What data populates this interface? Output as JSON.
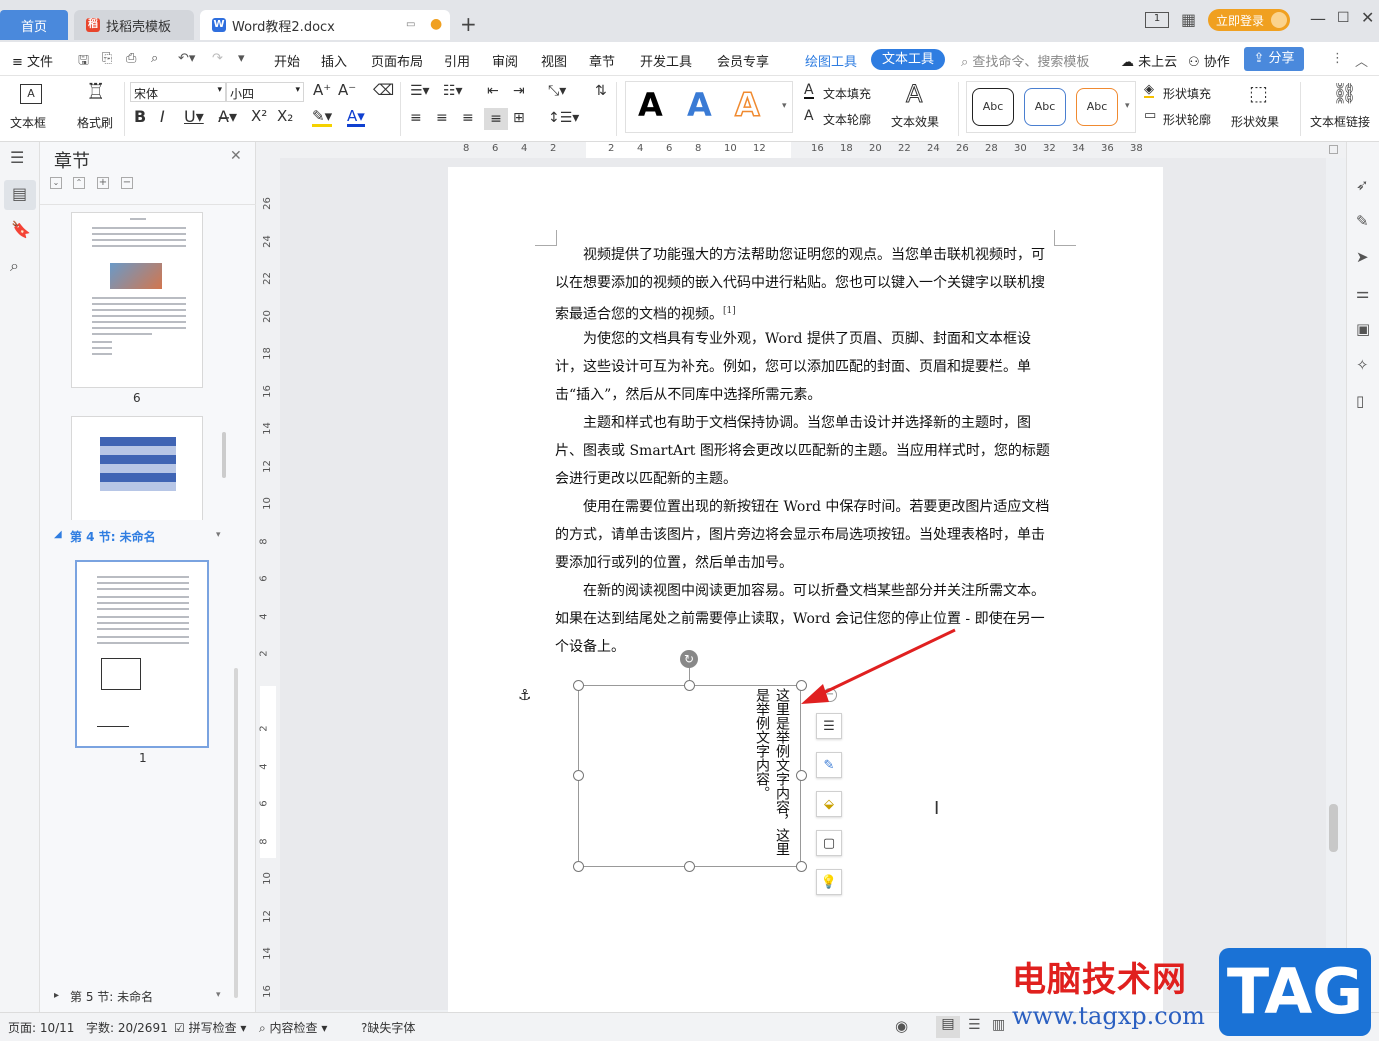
{
  "tabs": {
    "home": "首页",
    "template": "找稻壳模板",
    "doc": "Word教程2.docx",
    "new": "+"
  },
  "titlebar": {
    "login": "立即登录"
  },
  "menu": {
    "file": "文件",
    "items": [
      "开始",
      "插入",
      "页面布局",
      "引用",
      "审阅",
      "视图",
      "章节",
      "开发工具",
      "会员专享"
    ],
    "draw_tool": "绘图工具",
    "text_tool": "文本工具",
    "search": "查找命令、搜索模板",
    "cloud": "未上云",
    "collab": "协作",
    "share": "分享"
  },
  "ribbon": {
    "textbox": "文本框",
    "format_brush": "格式刷",
    "font": "宋体",
    "size": "小四",
    "text_fill": "文本填充",
    "text_outline": "文本轮廓",
    "text_effect": "文本效果",
    "shape_fill": "形状填充",
    "shape_outline": "形状轮廓",
    "shape_effect": "形状效果",
    "textbox_link": "文本框链接",
    "abc": "Abc",
    "big_a": "A"
  },
  "nav": {
    "title": "章节",
    "page6": "6",
    "page1": "1",
    "section4": "第 4 节: 未命名",
    "section5": "第 5 节: 未命名"
  },
  "ruler": {
    "h": [
      "8",
      "6",
      "4",
      "2",
      "",
      "2",
      "4",
      "6",
      "8",
      "10",
      "12",
      "",
      "16",
      "18",
      "20",
      "22",
      "24",
      "26",
      "28",
      "30",
      "32",
      "34",
      "36",
      "38"
    ],
    "v": [
      "26",
      "24",
      "22",
      "20",
      "18",
      "16",
      "14",
      "12",
      "10",
      "8",
      "6",
      "4",
      "2",
      "",
      "2",
      "4",
      "6",
      "8",
      "10",
      "12",
      "14",
      "16"
    ]
  },
  "doc": {
    "p1": "视频提供了功能强大的方法帮助您证明您的观点。当您单击联机视频时，可以在想要添加的视频的嵌入代码中进行粘贴。您也可以键入一个关键字以联机搜索最适合您的文档的视频。",
    "p1_ref": "[1]",
    "p2": "为使您的文档具有专业外观，Word 提供了页眉、页脚、封面和文本框设计，这些设计可互为补充。例如，您可以添加匹配的封面、页眉和提要栏。单击“插入”，然后从不同库中选择所需元素。",
    "p3": "主题和样式也有助于文档保持协调。当您单击设计并选择新的主题时，图片、图表或 SmartArt 图形将会更改以匹配新的主题。当应用样式时，您的标题会进行更改以匹配新的主题。",
    "p4": "使用在需要位置出现的新按钮在 Word 中保存时间。若要更改图片适应文档的方式，请单击该图片，图片旁边将会显示布局选项按钮。当处理表格时，单击要添加行或列的位置，然后单击加号。",
    "p5": "在新的阅读视图中阅读更加容易。可以折叠文档某些部分并关注所需文本。如果在达到结尾处之前需要停止读取，Word 会记住您的停止位置 - 即使在另一个设备上。",
    "tb_col1": "这里是举例文字内容，这里",
    "tb_col2": "是举例文字内容。"
  },
  "status": {
    "page": "页面: 10/11",
    "words": "字数: 20/2691",
    "spell": "拼写检查",
    "content": "内容检查",
    "font_missing": "缺失字体"
  },
  "watermark": {
    "title": "电脑技术网",
    "url": "www.tagxp.com",
    "tag": "TAG"
  },
  "colors": {
    "accent": "#4a89dc",
    "login": "#f0a020",
    "arrow": "#e02020",
    "watermark_red": "#e0201e"
  }
}
